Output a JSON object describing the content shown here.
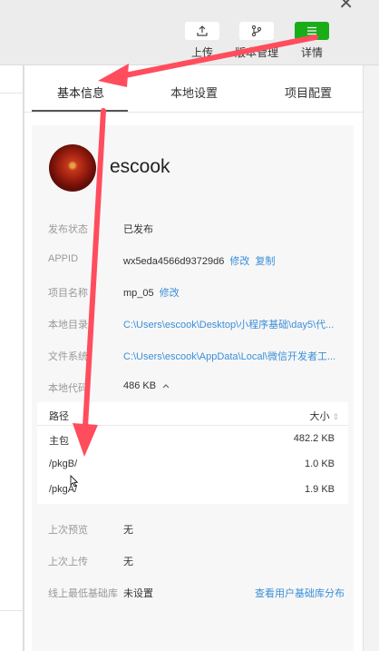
{
  "toolbar": {
    "close_glyph": "✕",
    "upload_label": "上传",
    "version_label": "版本管理",
    "detail_label": "详情"
  },
  "tabs": {
    "basic": "基本信息",
    "local": "本地设置",
    "project": "项目配置"
  },
  "profile": {
    "name": "escook"
  },
  "info": {
    "status_label": "发布状态",
    "status_value": "已发布",
    "appid_label": "APPID",
    "appid_value": "wx5eda4566d93729d6",
    "appid_edit": "修改",
    "appid_copy": "复制",
    "project_label": "项目名称",
    "project_value": "mp_05",
    "project_edit": "修改",
    "local_dir_label": "本地目录",
    "local_dir_value": "C:\\Users\\escook\\Desktop\\小程序基础\\day5\\代...",
    "fs_label": "文件系统",
    "fs_value": "C:\\Users\\escook\\AppData\\Local\\微信开发者工...",
    "code_label": "本地代码",
    "code_value": "486 KB",
    "preview_label": "上次预览",
    "preview_value": "无",
    "upload_label": "上次上传",
    "upload_value": "无",
    "lib_label": "线上最低基础库",
    "lib_value": "未设置",
    "lib_link": "查看用户基础库分布"
  },
  "packages": {
    "col_path": "路径",
    "col_size": "大小",
    "rows": [
      {
        "path": "主包",
        "size": "482.2 KB"
      },
      {
        "path": "/pkgB/",
        "size": "1.0 KB"
      },
      {
        "path": "/pkgA/",
        "size": "1.9 KB"
      }
    ]
  },
  "colors": {
    "accent": "#1aad19",
    "link": "#3a8fd8",
    "annotation_arrow": "#ff4d5e"
  }
}
